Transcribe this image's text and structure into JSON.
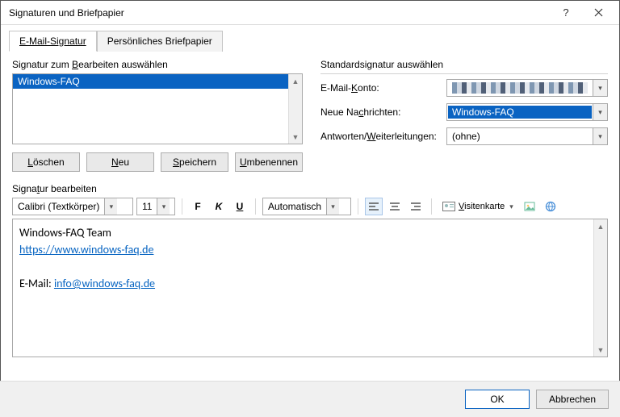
{
  "window": {
    "title": "Signaturen und Briefpapier"
  },
  "tabs": {
    "email": "E-Mail-Signatur",
    "stationery": "Persönliches Briefpapier"
  },
  "left": {
    "group_label": "Signatur zum Bearbeiten auswählen",
    "selected_item": "Windows-FAQ",
    "buttons": {
      "delete": "Löschen",
      "new": "Neu",
      "save": "Speichern",
      "rename": "Umbenennen"
    }
  },
  "right": {
    "group_label": "Standardsignatur auswählen",
    "account_label": "E-Mail-Konto:",
    "new_msg_label": "Neue Nachrichten:",
    "new_msg_value": "Windows-FAQ",
    "reply_label": "Antworten/Weiterleitungen:",
    "reply_value": "(ohne)"
  },
  "editor": {
    "group_label": "Signatur bearbeiten",
    "font_name": "Calibri (Textkörper)",
    "font_size": "11",
    "color_mode": "Automatisch",
    "vcard": "Visitenkarte",
    "content": {
      "line1": "Windows-FAQ Team",
      "link1": "https://www.windows-faq.de",
      "line3_prefix": "E-Mail: ",
      "link2": "info@windows-faq.de"
    }
  },
  "footer": {
    "ok": "OK",
    "cancel": "Abbrechen"
  }
}
